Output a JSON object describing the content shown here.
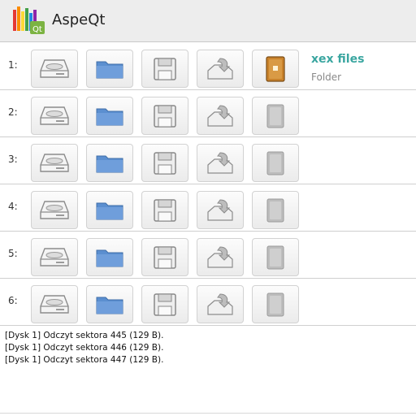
{
  "app": {
    "title": "AspeQt"
  },
  "slots": [
    {
      "number": "1:",
      "mounted": true,
      "file_name": "xex files",
      "file_type": "Folder"
    },
    {
      "number": "2:",
      "mounted": false
    },
    {
      "number": "3:",
      "mounted": false
    },
    {
      "number": "4:",
      "mounted": false
    },
    {
      "number": "5:",
      "mounted": false
    },
    {
      "number": "6:",
      "mounted": false
    }
  ],
  "slot_buttons": [
    "drive-icon",
    "folder-icon",
    "floppy-disk-icon",
    "eject-icon",
    "disk-image-icon"
  ],
  "log": [
    "[Dysk 1] Odczyt sektora 445 (129 B).",
    "[Dysk 1] Odczyt sektora 446 (129 B).",
    "[Dysk 1] Odczyt sektora 447 (129 B)."
  ],
  "colors": {
    "accent": "#3aa6a0",
    "folder_blue": "#5b8fd0",
    "mounted_orange": "#c9822b"
  }
}
